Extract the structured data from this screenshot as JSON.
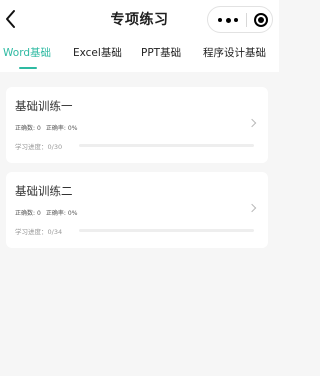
{
  "header": {
    "title": "专项练习",
    "back_icon": "chevron-left-icon",
    "capsule": {
      "more_icon": "more-icon",
      "close_icon": "target-icon"
    }
  },
  "tabs": [
    {
      "label": "Word基础",
      "active": true
    },
    {
      "label": "Excel基础",
      "active": false
    },
    {
      "label": "PPT基础",
      "active": false
    },
    {
      "label": "程序设计基础",
      "active": false
    }
  ],
  "accent_color": "#2ebaa2",
  "cards": [
    {
      "title": "基础训练一",
      "correct_label": "正确数:",
      "correct_value": "0",
      "rate_label": "正确率:",
      "rate_value": "0%",
      "progress_label": "学习进度：",
      "progress_text": "0/30",
      "progress_fraction": 0
    },
    {
      "title": "基础训练二",
      "correct_label": "正确数:",
      "correct_value": "0",
      "rate_label": "正确率:",
      "rate_value": "0%",
      "progress_label": "学习进度：",
      "progress_text": "0/34",
      "progress_fraction": 0
    }
  ]
}
